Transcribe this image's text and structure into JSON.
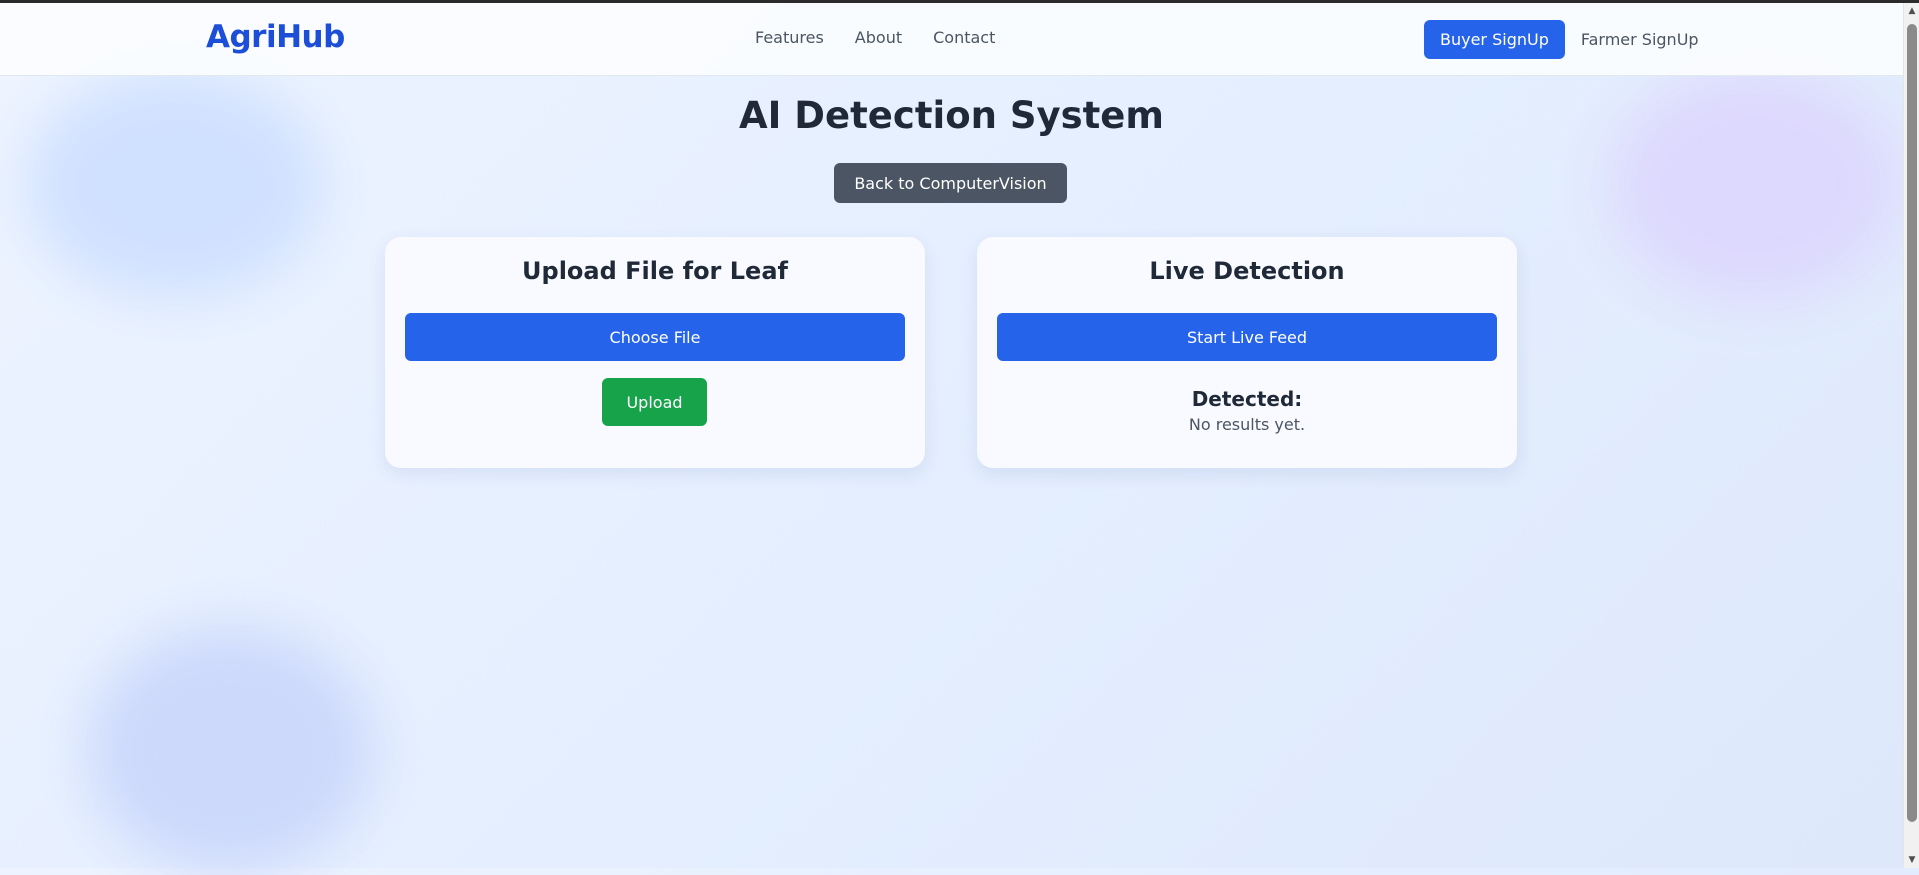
{
  "nav": {
    "brand": "AgriHub",
    "links": [
      "Features",
      "About",
      "Contact"
    ],
    "buyer_signup": "Buyer SignUp",
    "farmer_signup": "Farmer SignUp"
  },
  "page": {
    "title": "AI Detection System",
    "back_button": "Back to ComputerVision"
  },
  "upload_card": {
    "title": "Upload File for Leaf",
    "choose_file": "Choose File",
    "upload": "Upload"
  },
  "live_card": {
    "title": "Live Detection",
    "start_feed": "Start Live Feed",
    "detected_label": "Detected:",
    "detected_result": "No results yet."
  },
  "colors": {
    "brand": "#1d4ed8",
    "primary": "#2563eb",
    "success": "#16a34a",
    "secondary": "#4b5563"
  },
  "icons": [
    "scroll-up-arrow-icon",
    "scroll-down-arrow-icon"
  ]
}
